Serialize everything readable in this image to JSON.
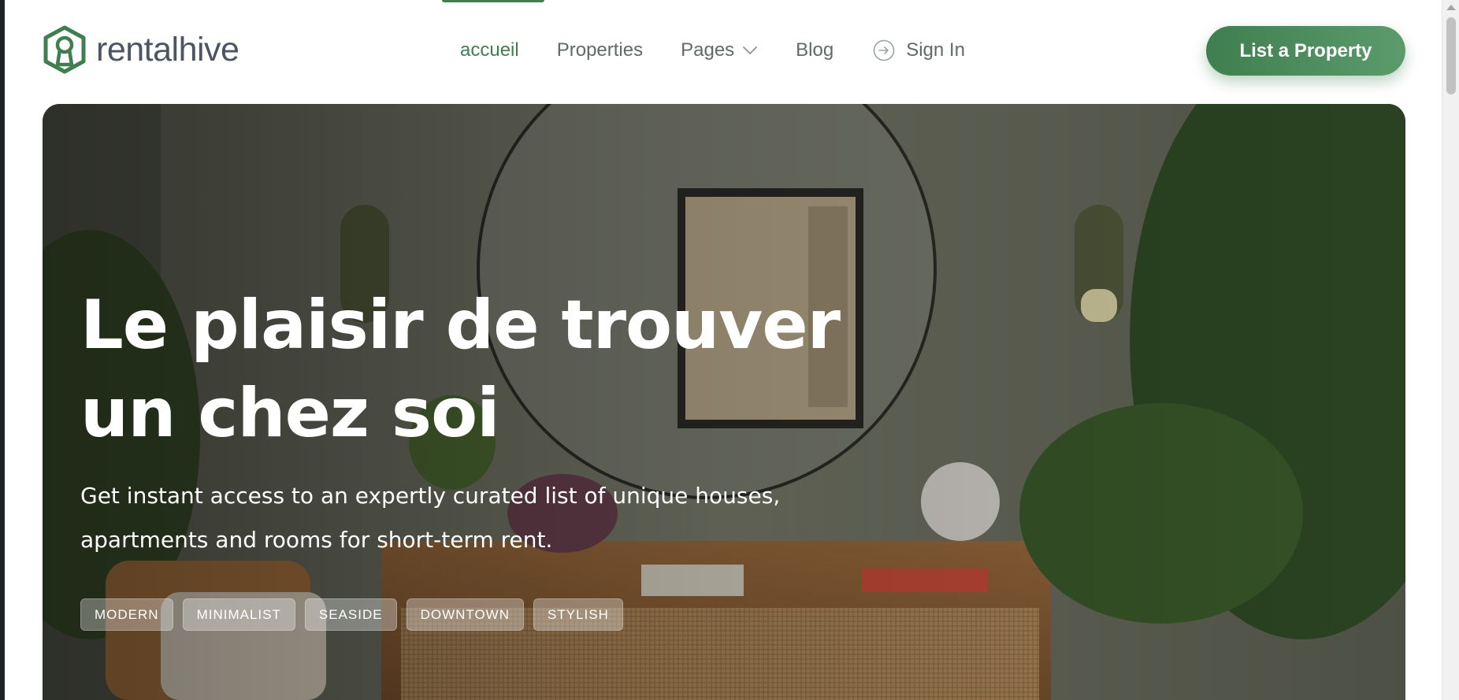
{
  "brand": {
    "name": "rentalhive",
    "color": "#3f7e4f"
  },
  "nav": {
    "items": [
      {
        "label": "accueil",
        "active": true
      },
      {
        "label": "Properties"
      },
      {
        "label": "Pages",
        "icon": "chevron-down-icon"
      },
      {
        "label": "Blog"
      },
      {
        "label": "Sign In",
        "icon": "sign-in-icon"
      }
    ]
  },
  "cta": {
    "label": "List a Property"
  },
  "hero": {
    "title_line1": "Le plaisir de trouver",
    "title_line2": "un chez soi",
    "subtitle_line1": "Get instant access to an expertly curated list of unique houses,",
    "subtitle_line2": "apartments and rooms for short-term rent.",
    "tags": [
      "MODERN",
      "MINIMALIST",
      "SEASIDE",
      "DOWNTOWN",
      "STYLISH"
    ]
  },
  "colors": {
    "accent": "#3f7e4f",
    "nav_text": "#5f6b68",
    "logo_text": "#4b5563"
  }
}
